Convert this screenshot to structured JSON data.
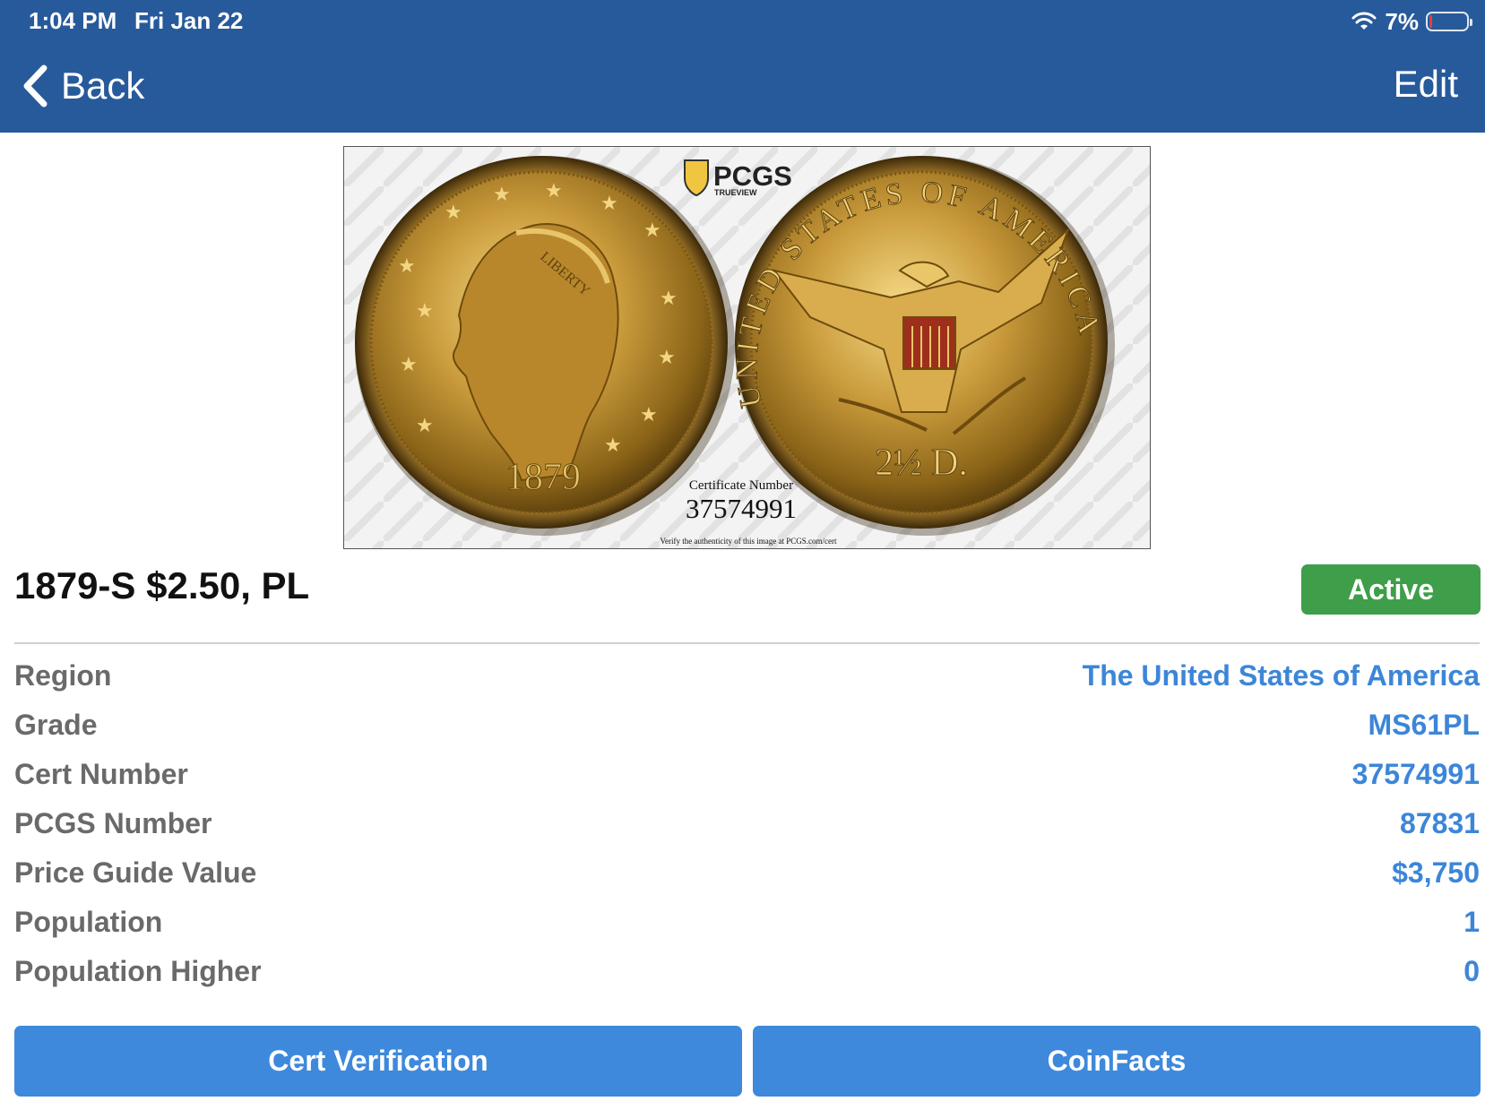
{
  "status_bar": {
    "time": "1:04 PM",
    "date": "Fri Jan 22",
    "battery_percent": "7%",
    "battery_level": 0.07
  },
  "nav": {
    "back_label": "Back",
    "edit_label": "Edit"
  },
  "coin_image": {
    "logo_text": "PCGS",
    "logo_subtext": "TRUEVIEW",
    "cert_caption": "Certificate Number",
    "cert_number": "37574991",
    "verify_text": "Verify the authenticity of this image at PCGS.com/cert",
    "obverse_year": "1879",
    "obverse_word": "LIBERTY",
    "reverse_legend": "UNITED STATES OF AMERICA",
    "reverse_denomination": "2½ D."
  },
  "coin": {
    "title": "1879-S $2.50, PL",
    "status": "Active"
  },
  "details": [
    {
      "label": "Region",
      "value": "The United States of America"
    },
    {
      "label": "Grade",
      "value": "MS61PL"
    },
    {
      "label": "Cert Number",
      "value": "37574991"
    },
    {
      "label": "PCGS Number",
      "value": "87831"
    },
    {
      "label": "Price Guide Value",
      "value": "$3,750"
    },
    {
      "label": "Population",
      "value": "1"
    },
    {
      "label": "Population Higher",
      "value": "0"
    }
  ],
  "actions": {
    "cert_verification": "Cert Verification",
    "coinfacts": "CoinFacts"
  },
  "colors": {
    "nav_background": "#275a9b",
    "active_badge": "#3e9e49",
    "button_blue": "#3e89dc",
    "value_blue": "#3c86d8",
    "label_gray": "#6a6a6a"
  }
}
